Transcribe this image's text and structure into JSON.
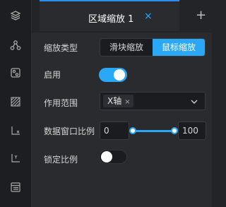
{
  "tab": {
    "title": "区域缩放 1",
    "close": "×",
    "add": "+"
  },
  "zoom_type": {
    "label": "缩放类型",
    "options": [
      "滑块缩放",
      "鼠标缩放"
    ],
    "selected": "鼠标缩放"
  },
  "enabled": {
    "label": "启用",
    "on": true
  },
  "scope": {
    "label": "作用范围",
    "selected_tag": "X轴",
    "tag_remove": "×"
  },
  "window_ratio": {
    "label": "数据窗口比例",
    "min": "0",
    "max": "100"
  },
  "lock_ratio": {
    "label": "锁定比例",
    "on": false
  },
  "colors": {
    "accent": "#2aa7f5",
    "panel": "#2a2b2f",
    "sidebar": "#1d1e21",
    "background": "#232428"
  },
  "sidebar_icons": [
    "layers-icon",
    "nodes-icon",
    "settings-card-icon",
    "hatch-square-icon",
    "x-axis-icon",
    "y-axis-icon",
    "list-icon"
  ]
}
